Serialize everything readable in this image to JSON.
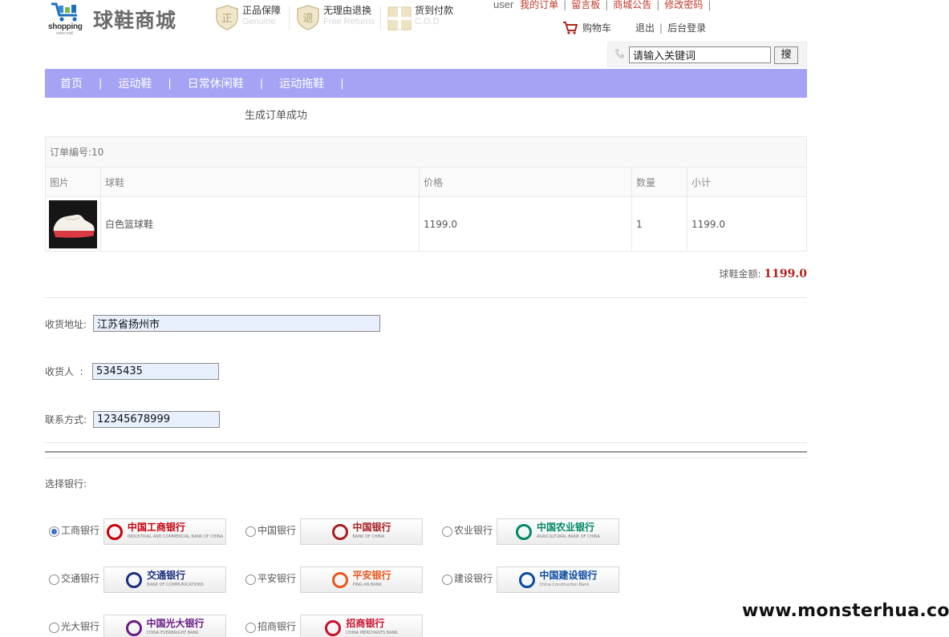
{
  "header": {
    "logo_text": "shopping",
    "logo_sub": "online mall",
    "store_name": "球鞋商城",
    "guarantees": [
      {
        "cn": "正品保障",
        "en": "Genuine",
        "icon": "seal-zheng-icon"
      },
      {
        "cn": "无理由退换",
        "en": "Free Returns",
        "icon": "seal-tui-icon"
      },
      {
        "cn": "货到付款",
        "en": "C.O.D",
        "icon": "gift-box-icon"
      }
    ],
    "user": "user",
    "links": [
      "我的订单",
      "留言板",
      "商城公告",
      "修改密码"
    ],
    "cart_label": "购物车",
    "logout": "退出",
    "admin_login": "后台登录",
    "search_placeholder": "请输入关键词",
    "search_button": "搜"
  },
  "nav": {
    "items": [
      "首页",
      "运动鞋",
      "日常休闲鞋",
      "运动拖鞋"
    ]
  },
  "main": {
    "success_message": "生成订单成功",
    "order_id_label": "订单编号:10",
    "columns": [
      "图片",
      "球鞋",
      "价格",
      "数量",
      "小计"
    ],
    "items": [
      {
        "name": "白色篮球鞋",
        "price": "1199.0",
        "quantity": "1",
        "subtotal": "1199.0"
      }
    ],
    "total_label": "球鞋金额:",
    "total_value": "1199.0"
  },
  "form": {
    "address_label": "收货地址:",
    "address_value": "江苏省扬州市",
    "receiver_label": "收货人  :",
    "receiver_value": "5345435",
    "contact_label": "联系方式:",
    "contact_value": "12345678999"
  },
  "banks": {
    "title": "选择银行:",
    "options": [
      {
        "name": "工商银行",
        "logo_text": "中国工商银行",
        "logo_sub": "INDUSTRIAL AND COMMERCIAL BANK OF CHINA",
        "checked": true,
        "color": "#c7000b"
      },
      {
        "name": "中国银行",
        "logo_text": "中国银行",
        "logo_sub": "BANK OF CHINA",
        "checked": false,
        "color": "#a71e23"
      },
      {
        "name": "农业银行",
        "logo_text": "中国农业银行",
        "logo_sub": "AGRICULTURAL BANK OF CHINA",
        "checked": false,
        "color": "#008867"
      },
      {
        "name": "交通银行",
        "logo_text": "交通银行",
        "logo_sub": "BANK OF COMMUNICATIONS",
        "checked": false,
        "color": "#1d2f7f"
      },
      {
        "name": "平安银行",
        "logo_text": "平安银行",
        "logo_sub": "PING AN BANK",
        "checked": false,
        "color": "#e8571e"
      },
      {
        "name": "建设银行",
        "logo_text": "中国建设银行",
        "logo_sub": "China Construction Bank",
        "checked": false,
        "color": "#0a4aa1"
      },
      {
        "name": "光大银行",
        "logo_text": "中国光大银行",
        "logo_sub": "CHINA EVERBRIGHT BANK",
        "checked": false,
        "color": "#6a1b86"
      },
      {
        "name": "招商银行",
        "logo_text": "招商银行",
        "logo_sub": "CHINA MERCHANTS BANK",
        "checked": false,
        "color": "#c8102e"
      }
    ]
  },
  "watermark": "www.monsterhua.com"
}
